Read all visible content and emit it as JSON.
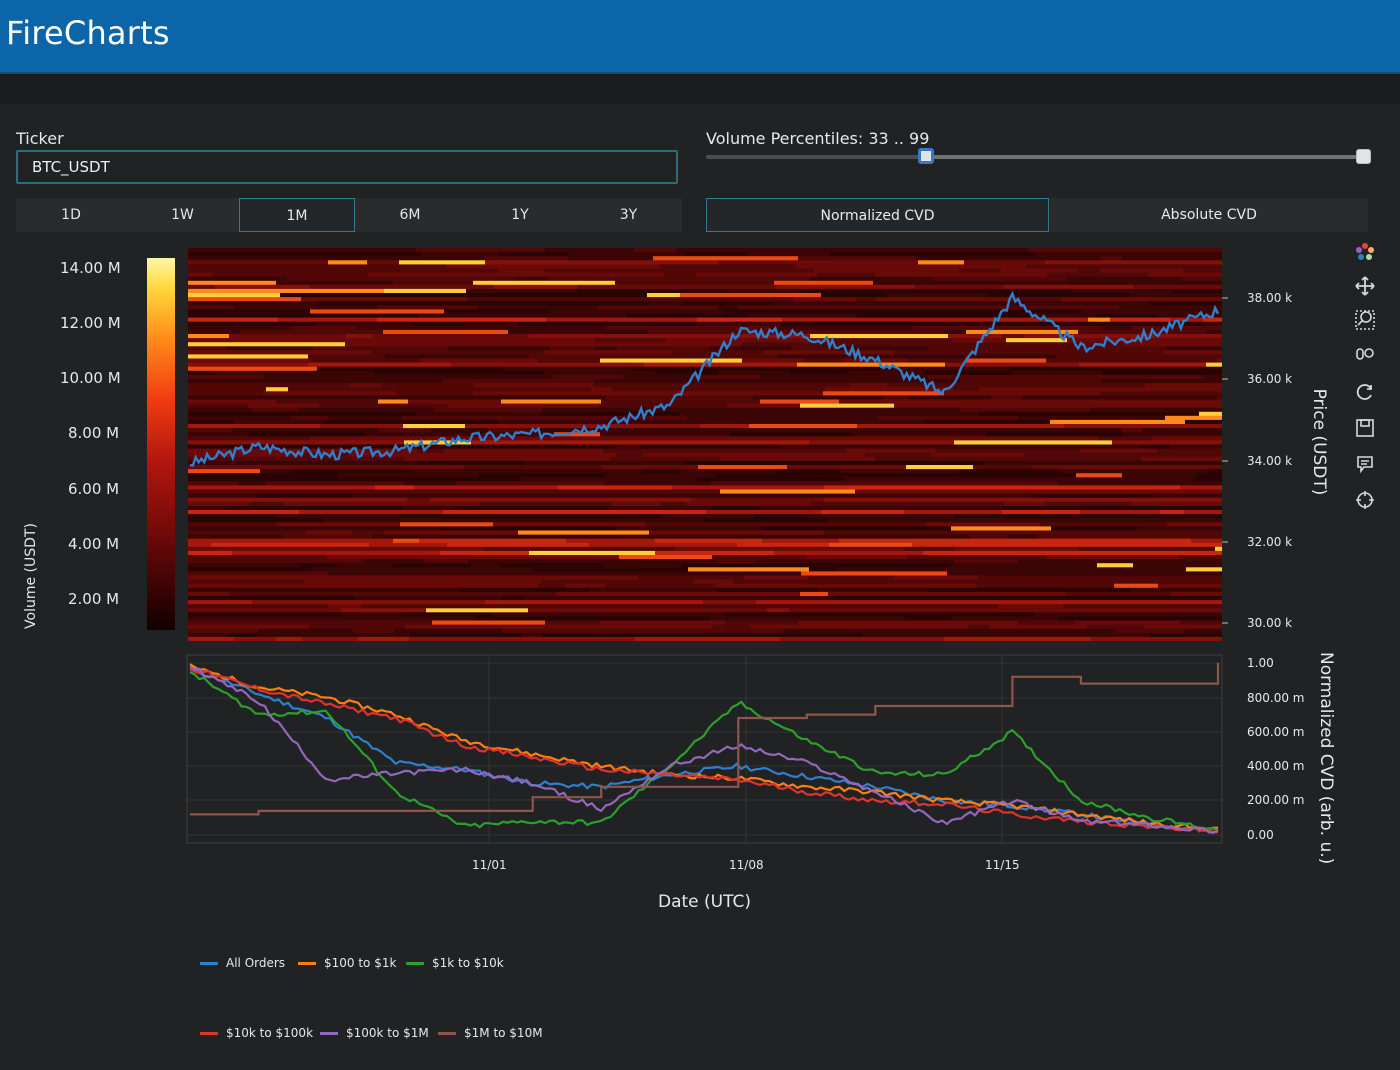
{
  "app": {
    "title": "FireCharts"
  },
  "ticker": {
    "label": "Ticker",
    "value": "BTC_USDT"
  },
  "ranges": {
    "items": [
      "1D",
      "1W",
      "1M",
      "6M",
      "1Y",
      "3Y"
    ],
    "active": "1M"
  },
  "volume_percentiles": {
    "label": "Volume Percentiles: 33 .. 99",
    "low": 33,
    "high": 99
  },
  "cvd_modes": {
    "normalized": "Normalized CVD",
    "absolute": "Absolute CVD",
    "active": "Normalized CVD"
  },
  "colors": {
    "header": "#0c64a9",
    "background": "#212223",
    "price_line": "#2f7fcf",
    "all_orders": "#2f7fcf",
    "r100_1k": "#ff7f0e",
    "r1k_10k": "#2ca02c",
    "r10k_100k": "#e0332d",
    "r100k_1m": "#9467bd",
    "r1m_10m": "#8c564b"
  },
  "heatmap": {
    "colorbar_ticks": [
      "14.00 M",
      "12.00 M",
      "10.00 M",
      "8.00 M",
      "6.00 M",
      "4.00 M",
      "2.00 M"
    ],
    "colorbar_title": "Volume (USDT)",
    "price_ticks": [
      "38.00 k",
      "36.00 k",
      "34.00 k",
      "32.00 k",
      "30.00 k"
    ],
    "price_title": "Price (USDT)"
  },
  "cvd_panel": {
    "y_ticks": [
      "1.00",
      "800.00 m",
      "600.00 m",
      "400.00 m",
      "200.00 m",
      "0.00"
    ],
    "y_title": "Normalized CVD (arb. u.)",
    "x_ticks": [
      "11/01",
      "11/08",
      "11/15"
    ],
    "x_title": "Date (UTC)"
  },
  "legend": [
    {
      "name": "All Orders",
      "color": "#2f7fcf"
    },
    {
      "name": "$100 to $1k",
      "color": "#ff7f0e"
    },
    {
      "name": "$1k to $10k",
      "color": "#2ca02c"
    },
    {
      "name": "$10k to $100k",
      "color": "#e0332d"
    },
    {
      "name": "$100k to $1M",
      "color": "#9467bd"
    },
    {
      "name": "$1M to $10M",
      "color": "#8c564b"
    }
  ],
  "toolbar": [
    "plotly-logo-icon",
    "pan-icon",
    "zoom-icon",
    "compare-icon",
    "reset-icon",
    "save-icon",
    "hover-icon",
    "spike-icon"
  ],
  "chart_data": [
    {
      "type": "line",
      "title": "",
      "xlabel": "",
      "ylabel": "Price (USDT)",
      "ylim": [
        29500,
        39000
      ],
      "x": [
        "10/25",
        "10/27",
        "10/29",
        "11/01",
        "11/03",
        "11/05",
        "11/08",
        "11/09",
        "11/10",
        "11/12",
        "11/14",
        "11/15",
        "11/16",
        "11/18",
        "11/20",
        "11/21"
      ],
      "series": [
        {
          "values": [
            33800,
            34200,
            34000,
            34100,
            34400,
            34500,
            34700,
            35200,
            37000,
            36900,
            36300,
            35500,
            37800,
            36600,
            36900,
            37500
          ]
        }
      ],
      "background": "heatmap of order volume",
      "colorbar": {
        "title": "Volume (USDT)",
        "range": [
          0,
          14000000
        ]
      }
    },
    {
      "type": "line",
      "xlabel": "Date (UTC)",
      "ylabel": "Normalized CVD (arb. u.)",
      "ylim": [
        0,
        1
      ],
      "x": [
        "10/25",
        "10/27",
        "10/29",
        "11/01",
        "11/03",
        "11/05",
        "11/08",
        "11/09",
        "11/10",
        "11/12",
        "11/14",
        "11/15",
        "11/16",
        "11/18",
        "11/20",
        "11/21"
      ],
      "series": [
        {
          "name": "All Orders",
          "values": [
            0.97,
            0.82,
            0.68,
            0.42,
            0.38,
            0.3,
            0.28,
            0.35,
            0.4,
            0.34,
            0.28,
            0.2,
            0.17,
            0.12,
            0.06,
            0.03
          ]
        },
        {
          "name": "$100 to $1k",
          "values": [
            0.98,
            0.86,
            0.8,
            0.7,
            0.55,
            0.47,
            0.4,
            0.35,
            0.33,
            0.28,
            0.25,
            0.2,
            0.17,
            0.12,
            0.07,
            0.03
          ]
        },
        {
          "name": "$1k to $10k",
          "values": [
            0.95,
            0.7,
            0.72,
            0.25,
            0.05,
            0.08,
            0.07,
            0.4,
            0.77,
            0.55,
            0.36,
            0.35,
            0.6,
            0.2,
            0.1,
            0.03
          ]
        },
        {
          "name": "$10k to $100k",
          "values": [
            0.97,
            0.85,
            0.76,
            0.68,
            0.52,
            0.45,
            0.38,
            0.35,
            0.32,
            0.25,
            0.2,
            0.18,
            0.12,
            0.08,
            0.05,
            0.02
          ]
        },
        {
          "name": "$100k to $1M",
          "values": [
            0.98,
            0.78,
            0.32,
            0.36,
            0.38,
            0.3,
            0.15,
            0.4,
            0.52,
            0.42,
            0.25,
            0.07,
            0.2,
            0.08,
            0.06,
            0.02
          ]
        },
        {
          "name": "$1M to $10M",
          "values": [
            0.12,
            0.14,
            0.14,
            0.14,
            0.14,
            0.22,
            0.28,
            0.28,
            0.68,
            0.7,
            0.75,
            0.75,
            0.92,
            0.88,
            0.88,
            1.0
          ]
        }
      ]
    }
  ]
}
